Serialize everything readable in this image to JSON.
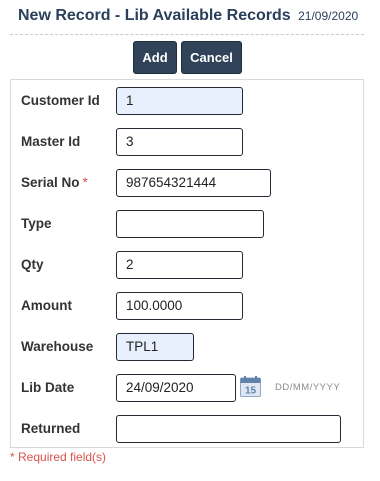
{
  "header": {
    "title": "New Record - Lib Available Records",
    "date": "21/09/2020"
  },
  "toolbar": {
    "add_label": "Add",
    "cancel_label": "Cancel"
  },
  "fields": {
    "customer_id": {
      "label": "Customer Id",
      "value": "1"
    },
    "master_id": {
      "label": "Master Id",
      "value": "3"
    },
    "serial_no": {
      "label": "Serial No",
      "required_mark": "*",
      "value": "987654321444"
    },
    "type": {
      "label": "Type",
      "value": ""
    },
    "qty": {
      "label": "Qty",
      "value": "2"
    },
    "amount": {
      "label": "Amount",
      "value": "100.0000"
    },
    "warehouse": {
      "label": "Warehouse",
      "value": "TPL1"
    },
    "lib_date": {
      "label": "Lib Date",
      "value": "24/09/2020",
      "format_hint": "DD/MM/YYYY",
      "calendar_day": "15"
    },
    "returned": {
      "label": "Returned",
      "value": ""
    }
  },
  "footer": {
    "required_note": "* Required field(s)"
  },
  "colors": {
    "button_bg": "#304358",
    "title": "#2a3f5a",
    "required": "#d9534f",
    "highlight_input": "#e8f0fe"
  },
  "icons": {
    "calendar": "calendar-icon"
  }
}
